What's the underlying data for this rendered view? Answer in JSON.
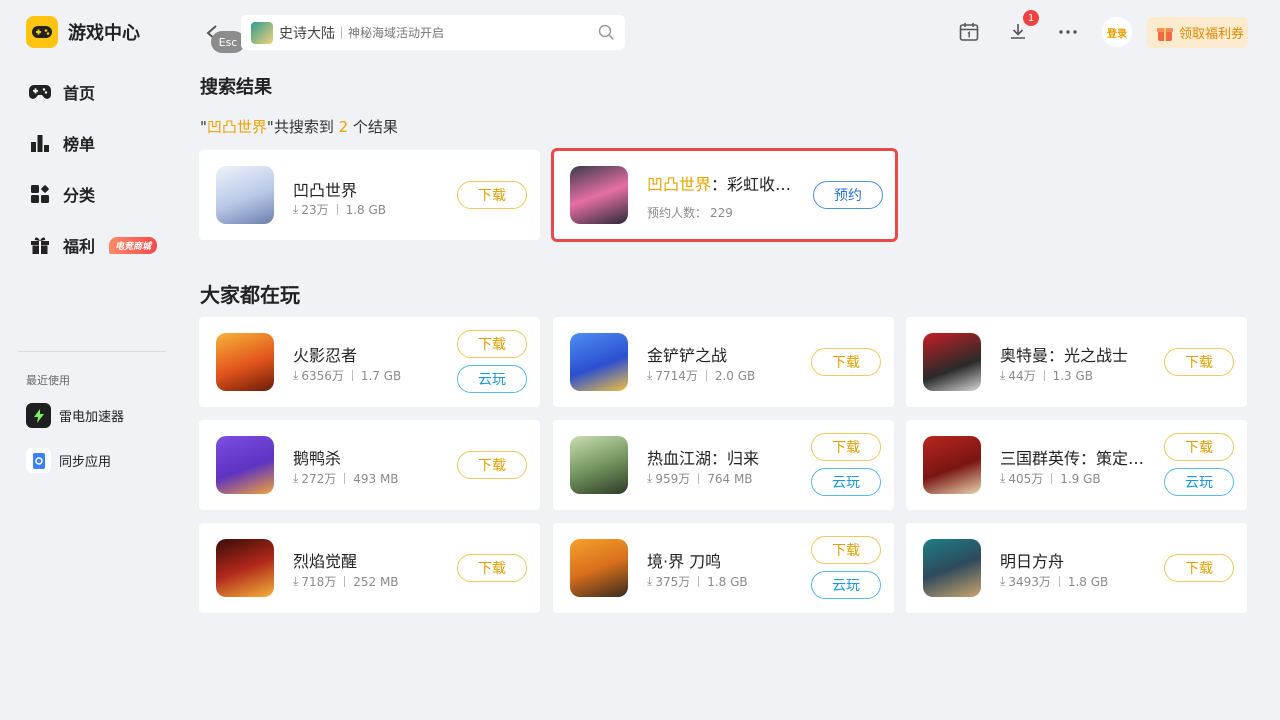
{
  "app": {
    "title": "游戏中心"
  },
  "colors": {
    "accent": "#ffc412",
    "highlight": "#eba400",
    "selection": "#e9494b",
    "badge": "#f04040"
  },
  "sidebar": {
    "items": [
      {
        "label": "首页",
        "icon": "gamepad-icon"
      },
      {
        "label": "榜单",
        "icon": "ranking-icon"
      },
      {
        "label": "分类",
        "icon": "category-icon"
      },
      {
        "label": "福利",
        "icon": "gift-icon",
        "badge": "电竞商城"
      }
    ],
    "recent_title": "最近使用",
    "recent": [
      {
        "label": "雷电加速器",
        "icon": "thunder-accelerator-icon"
      },
      {
        "label": "同步应用",
        "icon": "sync-app-icon"
      }
    ]
  },
  "header": {
    "back_hint": "Esc",
    "search": {
      "game": "史诗大陆",
      "subtitle": "神秘海域活动开启"
    },
    "download_badge": "1",
    "login_label": "登录",
    "coupon_label": "领取福利券"
  },
  "search_results": {
    "title": "搜索结果",
    "summary": {
      "quote_open": "\"",
      "keyword": "凹凸世界",
      "quote_close": "\"",
      "mid": "共搜索到 ",
      "count": "2",
      "end": " 个结果"
    },
    "items": [
      {
        "name": "凹凸世界",
        "downloads": "23万",
        "size": "1.8 GB",
        "button": "下载"
      },
      {
        "name_highlight": "凹凸世界",
        "name_rest": "：彩虹收…",
        "reservations_label": "预约人数：",
        "reservations": "229",
        "button": "预约"
      }
    ]
  },
  "popular": {
    "title": "大家都在玩",
    "download_label": "下载",
    "cloud_label": "云玩",
    "items": [
      {
        "name": "火影忍者",
        "downloads": "6356万",
        "size": "1.7 GB"
      },
      {
        "name": "金铲铲之战",
        "downloads": "7714万",
        "size": "2.0 GB"
      },
      {
        "name": "奥特曼：光之战士",
        "downloads": "44万",
        "size": "1.3 GB"
      },
      {
        "name": "鹅鸭杀",
        "downloads": "272万",
        "size": "493 MB"
      },
      {
        "name": "热血江湖：归来",
        "downloads": "959万",
        "size": "764 MB"
      },
      {
        "name": "三国群英传：策定…",
        "downloads": "405万",
        "size": "1.9 GB"
      },
      {
        "name": "烈焰觉醒",
        "downloads": "718万",
        "size": "252 MB"
      },
      {
        "name": "境·界 刀鸣",
        "downloads": "375万",
        "size": "1.8 GB"
      },
      {
        "name": "明日方舟",
        "downloads": "3493万",
        "size": "1.8 GB"
      }
    ]
  }
}
